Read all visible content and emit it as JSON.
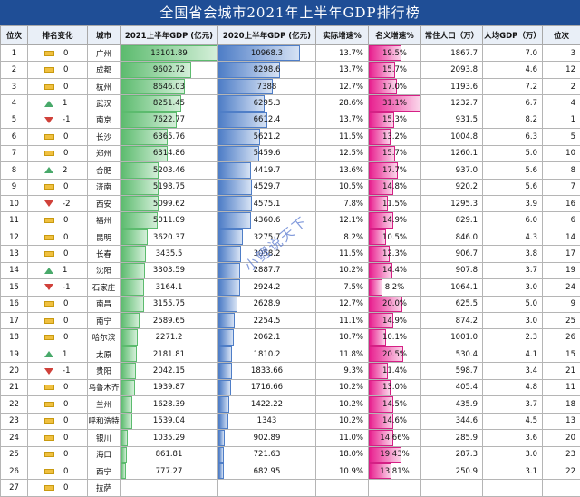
{
  "title": "全国省会城市2021年上半年GDP排行榜",
  "watermark": "小鲤说天下",
  "headers": [
    "位次",
    "排名变化",
    "城市",
    "2021上半年GDP (亿元)",
    "2020上半年GDP (亿元)",
    "实际增速%",
    "名义增速%",
    "常住人口（万）",
    "人均GDP（万）",
    "位次"
  ],
  "scales": {
    "gdp_max": 13101.89,
    "nominal_max": 31.1
  },
  "rows": [
    {
      "rank": "1",
      "chg_dir": "flat",
      "chg": "0",
      "city": "广州",
      "gdp21": "13101.89",
      "gdp20": "10968.3",
      "real": "13.7%",
      "nominal": "19.5%",
      "nom_v": 19.5,
      "g21": 13101.89,
      "g20": 10968.3,
      "pop": "1867.7",
      "pc": "7.0",
      "rank2": "3"
    },
    {
      "rank": "2",
      "chg_dir": "flat",
      "chg": "0",
      "city": "成都",
      "gdp21": "9602.72",
      "gdp20": "8298.6",
      "real": "13.7%",
      "nominal": "15.7%",
      "nom_v": 15.7,
      "g21": 9602.72,
      "g20": 8298.6,
      "pop": "2093.8",
      "pc": "4.6",
      "rank2": "12"
    },
    {
      "rank": "3",
      "chg_dir": "flat",
      "chg": "0",
      "city": "杭州",
      "gdp21": "8646.03",
      "gdp20": "7388",
      "real": "12.7%",
      "nominal": "17.0%",
      "nom_v": 17.0,
      "g21": 8646.03,
      "g20": 7388,
      "pop": "1193.6",
      "pc": "7.2",
      "rank2": "2"
    },
    {
      "rank": "4",
      "chg_dir": "up",
      "chg": "1",
      "city": "武汉",
      "gdp21": "8251.45",
      "gdp20": "6295.3",
      "real": "28.6%",
      "nominal": "31.1%",
      "nom_v": 31.1,
      "g21": 8251.45,
      "g20": 6295.3,
      "pop": "1232.7",
      "pc": "6.7",
      "rank2": "4"
    },
    {
      "rank": "5",
      "chg_dir": "down",
      "chg": "-1",
      "city": "南京",
      "gdp21": "7622.77",
      "gdp20": "6612.4",
      "real": "13.7%",
      "nominal": "15.3%",
      "nom_v": 15.3,
      "g21": 7622.77,
      "g20": 6612.4,
      "pop": "931.5",
      "pc": "8.2",
      "rank2": "1"
    },
    {
      "rank": "6",
      "chg_dir": "flat",
      "chg": "0",
      "city": "长沙",
      "gdp21": "6365.76",
      "gdp20": "5621.2",
      "real": "11.5%",
      "nominal": "13.2%",
      "nom_v": 13.2,
      "g21": 6365.76,
      "g20": 5621.2,
      "pop": "1004.8",
      "pc": "6.3",
      "rank2": "5"
    },
    {
      "rank": "7",
      "chg_dir": "flat",
      "chg": "0",
      "city": "郑州",
      "gdp21": "6314.86",
      "gdp20": "5459.6",
      "real": "12.5%",
      "nominal": "15.7%",
      "nom_v": 15.7,
      "g21": 6314.86,
      "g20": 5459.6,
      "pop": "1260.1",
      "pc": "5.0",
      "rank2": "10"
    },
    {
      "rank": "8",
      "chg_dir": "up",
      "chg": "2",
      "city": "合肥",
      "gdp21": "5203.46",
      "gdp20": "4419.7",
      "real": "13.6%",
      "nominal": "17.7%",
      "nom_v": 17.7,
      "g21": 5203.46,
      "g20": 4419.7,
      "pop": "937.0",
      "pc": "5.6",
      "rank2": "8"
    },
    {
      "rank": "9",
      "chg_dir": "flat",
      "chg": "0",
      "city": "济南",
      "gdp21": "5198.75",
      "gdp20": "4529.7",
      "real": "10.5%",
      "nominal": "14.8%",
      "nom_v": 14.8,
      "g21": 5198.75,
      "g20": 4529.7,
      "pop": "920.2",
      "pc": "5.6",
      "rank2": "7"
    },
    {
      "rank": "10",
      "chg_dir": "down",
      "chg": "-2",
      "city": "西安",
      "gdp21": "5099.62",
      "gdp20": "4575.1",
      "real": "7.8%",
      "nominal": "11.5%",
      "nom_v": 11.5,
      "g21": 5099.62,
      "g20": 4575.1,
      "pop": "1295.3",
      "pc": "3.9",
      "rank2": "16"
    },
    {
      "rank": "11",
      "chg_dir": "flat",
      "chg": "0",
      "city": "福州",
      "gdp21": "5011.09",
      "gdp20": "4360.6",
      "real": "12.1%",
      "nominal": "14.9%",
      "nom_v": 14.9,
      "g21": 5011.09,
      "g20": 4360.6,
      "pop": "829.1",
      "pc": "6.0",
      "rank2": "6"
    },
    {
      "rank": "12",
      "chg_dir": "flat",
      "chg": "0",
      "city": "昆明",
      "gdp21": "3620.37",
      "gdp20": "3275.7",
      "real": "8.2%",
      "nominal": "10.5%",
      "nom_v": 10.5,
      "g21": 3620.37,
      "g20": 3275.7,
      "pop": "846.0",
      "pc": "4.3",
      "rank2": "14"
    },
    {
      "rank": "13",
      "chg_dir": "flat",
      "chg": "0",
      "city": "长春",
      "gdp21": "3435.5",
      "gdp20": "3058.2",
      "real": "11.5%",
      "nominal": "12.3%",
      "nom_v": 12.3,
      "g21": 3435.5,
      "g20": 3058.2,
      "pop": "906.7",
      "pc": "3.8",
      "rank2": "17"
    },
    {
      "rank": "14",
      "chg_dir": "up",
      "chg": "1",
      "city": "沈阳",
      "gdp21": "3303.59",
      "gdp20": "2887.7",
      "real": "10.2%",
      "nominal": "14.4%",
      "nom_v": 14.4,
      "g21": 3303.59,
      "g20": 2887.7,
      "pop": "907.8",
      "pc": "3.7",
      "rank2": "19"
    },
    {
      "rank": "15",
      "chg_dir": "down",
      "chg": "-1",
      "city": "石家庄",
      "gdp21": "3164.1",
      "gdp20": "2924.2",
      "real": "7.5%",
      "nominal": "8.2%",
      "nom_v": 8.2,
      "g21": 3164.1,
      "g20": 2924.2,
      "pop": "1064.1",
      "pc": "3.0",
      "rank2": "24"
    },
    {
      "rank": "16",
      "chg_dir": "flat",
      "chg": "0",
      "city": "南昌",
      "gdp21": "3155.75",
      "gdp20": "2628.9",
      "real": "12.7%",
      "nominal": "20.0%",
      "nom_v": 20.0,
      "g21": 3155.75,
      "g20": 2628.9,
      "pop": "625.5",
      "pc": "5.0",
      "rank2": "9"
    },
    {
      "rank": "17",
      "chg_dir": "flat",
      "chg": "0",
      "city": "南宁",
      "gdp21": "2589.65",
      "gdp20": "2254.5",
      "real": "11.1%",
      "nominal": "14.9%",
      "nom_v": 14.9,
      "g21": 2589.65,
      "g20": 2254.5,
      "pop": "874.2",
      "pc": "3.0",
      "rank2": "25"
    },
    {
      "rank": "18",
      "chg_dir": "flat",
      "chg": "0",
      "city": "哈尔滨",
      "gdp21": "2271.2",
      "gdp20": "2062.1",
      "real": "10.7%",
      "nominal": "10.1%",
      "nom_v": 10.1,
      "g21": 2271.2,
      "g20": 2062.1,
      "pop": "1001.0",
      "pc": "2.3",
      "rank2": "26"
    },
    {
      "rank": "19",
      "chg_dir": "up",
      "chg": "1",
      "city": "太原",
      "gdp21": "2181.81",
      "gdp20": "1810.2",
      "real": "11.8%",
      "nominal": "20.5%",
      "nom_v": 20.5,
      "g21": 2181.81,
      "g20": 1810.2,
      "pop": "530.4",
      "pc": "4.1",
      "rank2": "15"
    },
    {
      "rank": "20",
      "chg_dir": "down",
      "chg": "-1",
      "city": "贵阳",
      "gdp21": "2042.15",
      "gdp20": "1833.66",
      "real": "9.3%",
      "nominal": "11.4%",
      "nom_v": 11.4,
      "g21": 2042.15,
      "g20": 1833.66,
      "pop": "598.7",
      "pc": "3.4",
      "rank2": "21"
    },
    {
      "rank": "21",
      "chg_dir": "flat",
      "chg": "0",
      "city": "乌鲁木齐",
      "gdp21": "1939.87",
      "gdp20": "1716.66",
      "real": "10.2%",
      "nominal": "13.0%",
      "nom_v": 13.0,
      "g21": 1939.87,
      "g20": 1716.66,
      "pop": "405.4",
      "pc": "4.8",
      "rank2": "11"
    },
    {
      "rank": "22",
      "chg_dir": "flat",
      "chg": "0",
      "city": "兰州",
      "gdp21": "1628.39",
      "gdp20": "1422.22",
      "real": "10.2%",
      "nominal": "14.5%",
      "nom_v": 14.5,
      "g21": 1628.39,
      "g20": 1422.22,
      "pop": "435.9",
      "pc": "3.7",
      "rank2": "18"
    },
    {
      "rank": "23",
      "chg_dir": "flat",
      "chg": "0",
      "city": "呼和浩特",
      "gdp21": "1539.04",
      "gdp20": "1343",
      "real": "10.2%",
      "nominal": "14.6%",
      "nom_v": 14.6,
      "g21": 1539.04,
      "g20": 1343,
      "pop": "344.6",
      "pc": "4.5",
      "rank2": "13"
    },
    {
      "rank": "24",
      "chg_dir": "flat",
      "chg": "0",
      "city": "银川",
      "gdp21": "1035.29",
      "gdp20": "902.89",
      "real": "11.0%",
      "nominal": "14.66%",
      "nom_v": 14.66,
      "g21": 1035.29,
      "g20": 902.89,
      "pop": "285.9",
      "pc": "3.6",
      "rank2": "20"
    },
    {
      "rank": "25",
      "chg_dir": "flat",
      "chg": "0",
      "city": "海口",
      "gdp21": "861.81",
      "gdp20": "721.63",
      "real": "18.0%",
      "nominal": "19.43%",
      "nom_v": 19.43,
      "g21": 861.81,
      "g20": 721.63,
      "pop": "287.3",
      "pc": "3.0",
      "rank2": "23"
    },
    {
      "rank": "26",
      "chg_dir": "flat",
      "chg": "0",
      "city": "西宁",
      "gdp21": "777.27",
      "gdp20": "682.95",
      "real": "10.9%",
      "nominal": "13.81%",
      "nom_v": 13.81,
      "g21": 777.27,
      "g20": 682.95,
      "pop": "250.9",
      "pc": "3.1",
      "rank2": "22"
    },
    {
      "rank": "27",
      "chg_dir": "flat",
      "chg": "0",
      "city": "拉萨",
      "gdp21": "",
      "gdp20": "",
      "real": "",
      "nominal": "",
      "nom_v": 0,
      "g21": 0,
      "g20": 0,
      "pop": "",
      "pc": "",
      "rank2": ""
    }
  ]
}
